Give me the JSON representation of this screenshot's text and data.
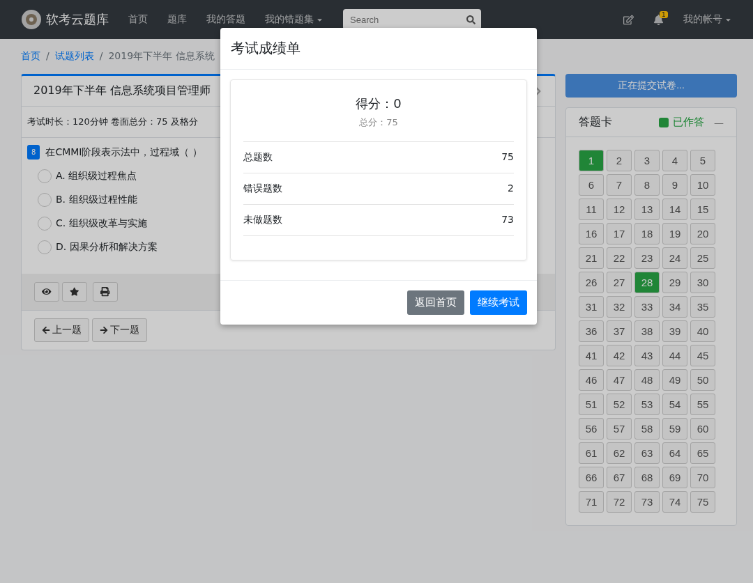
{
  "navbar": {
    "brand": "软考云题库",
    "items": [
      {
        "label": "首页",
        "dropdown": false
      },
      {
        "label": "题库",
        "dropdown": false
      },
      {
        "label": "我的答题",
        "dropdown": false
      },
      {
        "label": "我的错题集",
        "dropdown": true
      }
    ],
    "search": {
      "placeholder": "Search"
    },
    "notification_count": "1",
    "account": "我的帐号"
  },
  "breadcrumb": [
    {
      "label": "首页",
      "link": true
    },
    {
      "separator": "/",
      "label": "试题列表",
      "link": true
    },
    {
      "separator": "/",
      "label": "2019年下半年 信息系统",
      "link": false
    }
  ],
  "exam": {
    "title": "2019年下半年 信息系统项目管理师",
    "info": "考试时长：120分钟 卷面总分：75 及格分",
    "question_number": "8",
    "question": "在CMMI阶段表示法中，过程域（ ）",
    "options": [
      {
        "label": "A. 组织级过程焦点",
        "selected": false
      },
      {
        "label": "B. 组织级过程性能",
        "selected": false
      },
      {
        "label": "C. 组织级改革与实施",
        "selected": false
      },
      {
        "label": "D. 因果分析和解决方案",
        "selected": false
      }
    ],
    "prev": "上一题",
    "next": "下一题"
  },
  "submit_button": "正在提交试卷...",
  "answer_card": {
    "title": "答题卡",
    "legend": "已作答",
    "collapse": "—",
    "items": [
      {
        "label": "1",
        "answered": true
      },
      {
        "label": "2",
        "answered": false
      },
      {
        "label": "3",
        "answered": false
      },
      {
        "label": "4",
        "answered": false
      },
      {
        "label": "5",
        "answered": false
      },
      {
        "label": "6",
        "answered": false
      },
      {
        "label": "7",
        "answered": false
      },
      {
        "label": "8",
        "answered": false
      },
      {
        "label": "9",
        "answered": false
      },
      {
        "label": "10",
        "answered": false
      },
      {
        "label": "11",
        "answered": false
      },
      {
        "label": "12",
        "answered": false
      },
      {
        "label": "13",
        "answered": false
      },
      {
        "label": "14",
        "answered": false
      },
      {
        "label": "15",
        "answered": false
      },
      {
        "label": "16",
        "answered": false
      },
      {
        "label": "17",
        "answered": false
      },
      {
        "label": "18",
        "answered": false
      },
      {
        "label": "19",
        "answered": false
      },
      {
        "label": "20",
        "answered": false
      },
      {
        "label": "21",
        "answered": false
      },
      {
        "label": "22",
        "answered": false
      },
      {
        "label": "23",
        "answered": false
      },
      {
        "label": "24",
        "answered": false
      },
      {
        "label": "25",
        "answered": false
      },
      {
        "label": "26",
        "answered": false
      },
      {
        "label": "27",
        "answered": false
      },
      {
        "label": "28",
        "answered": true
      },
      {
        "label": "29",
        "answered": false
      },
      {
        "label": "30",
        "answered": false
      },
      {
        "label": "31",
        "answered": false
      },
      {
        "label": "32",
        "answered": false
      },
      {
        "label": "33",
        "answered": false
      },
      {
        "label": "34",
        "answered": false
      },
      {
        "label": "35",
        "answered": false
      },
      {
        "label": "36",
        "answered": false
      },
      {
        "label": "37",
        "answered": false
      },
      {
        "label": "38",
        "answered": false
      },
      {
        "label": "39",
        "answered": false
      },
      {
        "label": "40",
        "answered": false
      },
      {
        "label": "41",
        "answered": false
      },
      {
        "label": "42",
        "answered": false
      },
      {
        "label": "43",
        "answered": false
      },
      {
        "label": "44",
        "answered": false
      },
      {
        "label": "45",
        "answered": false
      },
      {
        "label": "46",
        "answered": false
      },
      {
        "label": "47",
        "answered": false
      },
      {
        "label": "48",
        "answered": false
      },
      {
        "label": "49",
        "answered": false
      },
      {
        "label": "50",
        "answered": false
      },
      {
        "label": "51",
        "answered": false
      },
      {
        "label": "52",
        "answered": false
      },
      {
        "label": "53",
        "answered": false
      },
      {
        "label": "54",
        "answered": false
      },
      {
        "label": "55",
        "answered": false
      },
      {
        "label": "56",
        "answered": false
      },
      {
        "label": "57",
        "answered": false
      },
      {
        "label": "58",
        "answered": false
      },
      {
        "label": "59",
        "answered": false
      },
      {
        "label": "60",
        "answered": false
      },
      {
        "label": "61",
        "answered": false
      },
      {
        "label": "62",
        "answered": false
      },
      {
        "label": "63",
        "answered": false
      },
      {
        "label": "64",
        "answered": false
      },
      {
        "label": "65",
        "answered": false
      },
      {
        "label": "66",
        "answered": false
      },
      {
        "label": "67",
        "answered": false
      },
      {
        "label": "68",
        "answered": false
      },
      {
        "label": "69",
        "answered": false
      },
      {
        "label": "70",
        "answered": false
      },
      {
        "label": "71",
        "answered": false
      },
      {
        "label": "72",
        "answered": false
      },
      {
        "label": "73",
        "answered": false
      },
      {
        "label": "74",
        "answered": false
      },
      {
        "label": "75",
        "answered": false
      }
    ]
  },
  "modal": {
    "title": "考试成绩单",
    "score": "得分：0",
    "total": "总分：75",
    "stats": [
      {
        "label": "总题数",
        "value": "75"
      },
      {
        "label": "错误题数",
        "value": "2"
      },
      {
        "label": "未做题数",
        "value": "73"
      }
    ],
    "buttons": [
      {
        "label": "返回首页",
        "kind": "secondary"
      },
      {
        "label": "继续考试",
        "kind": "primary"
      }
    ]
  }
}
